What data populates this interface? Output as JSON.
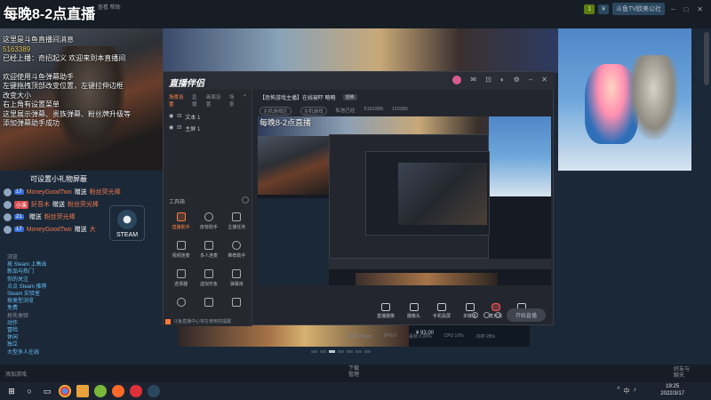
{
  "stream_title": "每晚8-2点直播",
  "steam": {
    "top_left_menu": "查看 帮助",
    "nav_fragments": [
      "库",
      "社区",
      "斗鱼TV欧美公社",
      "购物车(0)"
    ],
    "user_chip": "斗鱼TV欧美公社",
    "balance_chip": "¥",
    "notif_chip": "1",
    "side_links": [
      "浏览",
      "按 Steam 上售出",
      "新品与热门",
      "你的关注",
      "点点 Steam 推荐",
      "Steam 实验室",
      "按类型浏览",
      "免费",
      "抢先体验",
      "动作",
      "冒险",
      "休闲",
      "独立",
      "大型多人在线"
    ],
    "price": "¥ 93.00",
    "bottom_add": "添加游戏",
    "bottom_downloads": "下载",
    "bottom_downloads_sub": "管理",
    "bottom_friends": "好友与",
    "bottom_friends_sub": "聊天"
  },
  "chat": {
    "lines": [
      {
        "text": "这里是斗鱼直播间消息",
        "hl": false
      },
      {
        "text": "5163389",
        "hl": true
      },
      {
        "text": "已经上播：奇招起义 欢迎来到本直播间",
        "hl": false
      },
      {
        "text": "",
        "hl": false
      },
      {
        "text": "欢迎使用斗鱼弹幕助手",
        "hl": false
      },
      {
        "text": "左键拖拽顶部改变位置，左键拉伸边框",
        "hl": false
      },
      {
        "text": "改变大小",
        "hl": false
      },
      {
        "text": "右上角有设置菜单",
        "hl": false
      },
      {
        "text": "这里展示弹幕、贵族弹幕、粉丝牌升级等",
        "hl": false
      },
      {
        "text": "添加弹幕助手成功",
        "hl": false
      }
    ]
  },
  "gift": {
    "tip": "可设置小礼物屏蔽",
    "rows": [
      {
        "level": "17",
        "name": "MoneyGoodTwo",
        "verb": "赠送",
        "gift": "粉丝荧光棒",
        "red": false
      },
      {
        "level": "小溪",
        "name": "好吾木",
        "verb": "赠送",
        "gift": "粉丝荧光棒",
        "red": true
      },
      {
        "level": "21",
        "name": "",
        "verb": "赠送",
        "gift": "粉丝荧光棒",
        "red": false
      },
      {
        "level": "17",
        "name": "MoneyGoodTwo",
        "verb": "赠送",
        "gift": "大",
        "red": false
      }
    ]
  },
  "steam_badge": "STEAM",
  "obs": {
    "logo": "直播伴侣",
    "tabs": [
      "场景设置",
      "直播",
      "画面设置",
      "场景"
    ],
    "scenes": [
      "文本 1",
      "主屏 1"
    ],
    "tools_title": "工具箱",
    "tools": [
      {
        "label": "直播助手",
        "active": true
      },
      {
        "label": "房管助手",
        "active": false
      },
      {
        "label": "主播任务",
        "active": false
      },
      {
        "label": "视频连麦",
        "active": false
      },
      {
        "label": "多人连麦",
        "active": false
      },
      {
        "label": "推荐助手",
        "active": false
      },
      {
        "label": "选择器",
        "active": false
      },
      {
        "label": "虚拟形象",
        "active": false
      },
      {
        "label": "弹幕库",
        "active": false
      },
      {
        "label": "",
        "active": false
      },
      {
        "label": "",
        "active": false
      },
      {
        "label": "",
        "active": false
      }
    ],
    "footer": "斗鱼直播中心将在使用前提醒",
    "room_title": "【恐怖游戏主播】在线被吓 略略",
    "room_tag": "恐怖",
    "sub_items": [
      "主机游戏区",
      "主机游戏",
      "私信已经",
      "5163389",
      "110380"
    ],
    "controls": [
      "直播摄像",
      "摄像头",
      "手机投屏",
      "多媒体",
      "麦克风",
      "扬声器"
    ],
    "start_button": "开始直播",
    "status": [
      "码率 0 kbps",
      "FPS 0",
      "丢帧 0.00%",
      "CPU 10%",
      "内存 28%"
    ]
  },
  "taskbar": {
    "time": "19:25",
    "date": "2022/3/17",
    "tray": [
      "^",
      "中",
      "♪"
    ]
  }
}
